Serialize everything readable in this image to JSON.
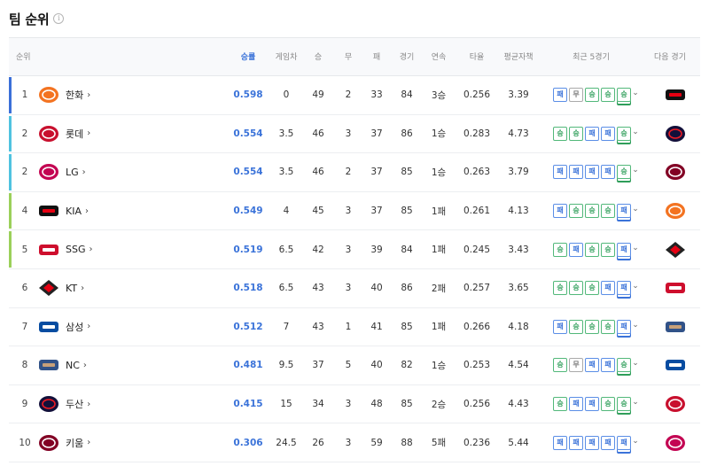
{
  "page": {
    "title": "팀 순위",
    "info_icon": "info-icon"
  },
  "columns": {
    "rank": "순위",
    "pct": "승률",
    "gb": "게임차",
    "win": "승",
    "draw": "무",
    "loss": "패",
    "games": "경기",
    "streak": "연속",
    "avg": "타율",
    "era": "평균자책",
    "recent": "최근 5경기",
    "next": "다음 경기"
  },
  "colors": {
    "accent": "#3b73d9",
    "rank_1": "#3b6fd8",
    "rank_2_3": "#4fc3e0",
    "rank_4_5": "#9bd05a",
    "win": "#2f9e5a",
    "loss": "#3b73d9"
  },
  "result_labels": {
    "W": "승",
    "L": "패",
    "D": "무"
  },
  "rows": [
    {
      "rank": "1",
      "team": "한화",
      "logo": "eagles-logo",
      "pct": "0.598",
      "gb": "0",
      "win": "49",
      "draw": "2",
      "loss": "33",
      "games": "84",
      "streak": "3승",
      "avg": "0.256",
      "era": "3.39",
      "recent": [
        "L",
        "D",
        "W",
        "W",
        "W"
      ],
      "next_logo": "tigers-logo",
      "bar": "rank_1"
    },
    {
      "rank": "2",
      "team": "롯데",
      "logo": "giants-logo",
      "pct": "0.554",
      "gb": "3.5",
      "win": "46",
      "draw": "3",
      "loss": "37",
      "games": "86",
      "streak": "1승",
      "avg": "0.283",
      "era": "4.73",
      "recent": [
        "W",
        "W",
        "L",
        "L",
        "W"
      ],
      "next_logo": "bears-logo",
      "bar": "rank_2_3"
    },
    {
      "rank": "2",
      "team": "LG",
      "logo": "twins-logo",
      "pct": "0.554",
      "gb": "3.5",
      "win": "46",
      "draw": "2",
      "loss": "37",
      "games": "85",
      "streak": "1승",
      "avg": "0.263",
      "era": "3.79",
      "recent": [
        "L",
        "L",
        "L",
        "L",
        "W"
      ],
      "next_logo": "heroes-logo",
      "bar": "rank_2_3"
    },
    {
      "rank": "4",
      "team": "KIA",
      "logo": "tigers-logo",
      "pct": "0.549",
      "gb": "4",
      "win": "45",
      "draw": "3",
      "loss": "37",
      "games": "85",
      "streak": "1패",
      "avg": "0.261",
      "era": "4.13",
      "recent": [
        "L",
        "W",
        "W",
        "W",
        "L"
      ],
      "next_logo": "eagles-logo",
      "bar": "rank_4_5"
    },
    {
      "rank": "5",
      "team": "SSG",
      "logo": "landers-logo",
      "pct": "0.519",
      "gb": "6.5",
      "win": "42",
      "draw": "3",
      "loss": "39",
      "games": "84",
      "streak": "1패",
      "avg": "0.245",
      "era": "3.43",
      "recent": [
        "W",
        "L",
        "W",
        "W",
        "L"
      ],
      "next_logo": "wiz-logo",
      "bar": "rank_4_5"
    },
    {
      "rank": "6",
      "team": "KT",
      "logo": "wiz-logo",
      "pct": "0.518",
      "gb": "6.5",
      "win": "43",
      "draw": "3",
      "loss": "40",
      "games": "86",
      "streak": "2패",
      "avg": "0.257",
      "era": "3.65",
      "recent": [
        "W",
        "W",
        "W",
        "L",
        "L"
      ],
      "next_logo": "landers-logo",
      "bar": ""
    },
    {
      "rank": "7",
      "team": "삼성",
      "logo": "lions-logo",
      "pct": "0.512",
      "gb": "7",
      "win": "43",
      "draw": "1",
      "loss": "41",
      "games": "85",
      "streak": "1패",
      "avg": "0.266",
      "era": "4.18",
      "recent": [
        "L",
        "W",
        "W",
        "W",
        "L"
      ],
      "next_logo": "dinos-logo",
      "bar": ""
    },
    {
      "rank": "8",
      "team": "NC",
      "logo": "dinos-logo",
      "pct": "0.481",
      "gb": "9.5",
      "win": "37",
      "draw": "5",
      "loss": "40",
      "games": "82",
      "streak": "1승",
      "avg": "0.253",
      "era": "4.54",
      "recent": [
        "W",
        "D",
        "L",
        "L",
        "W"
      ],
      "next_logo": "lions-logo",
      "bar": ""
    },
    {
      "rank": "9",
      "team": "두산",
      "logo": "bears-logo",
      "pct": "0.415",
      "gb": "15",
      "win": "34",
      "draw": "3",
      "loss": "48",
      "games": "85",
      "streak": "2승",
      "avg": "0.256",
      "era": "4.43",
      "recent": [
        "W",
        "L",
        "L",
        "W",
        "W"
      ],
      "next_logo": "giants-logo",
      "bar": ""
    },
    {
      "rank": "10",
      "team": "키움",
      "logo": "heroes-logo",
      "pct": "0.306",
      "gb": "24.5",
      "win": "26",
      "draw": "3",
      "loss": "59",
      "games": "88",
      "streak": "5패",
      "avg": "0.236",
      "era": "5.44",
      "recent": [
        "L",
        "L",
        "L",
        "L",
        "L"
      ],
      "next_logo": "twins-logo",
      "bar": ""
    }
  ]
}
